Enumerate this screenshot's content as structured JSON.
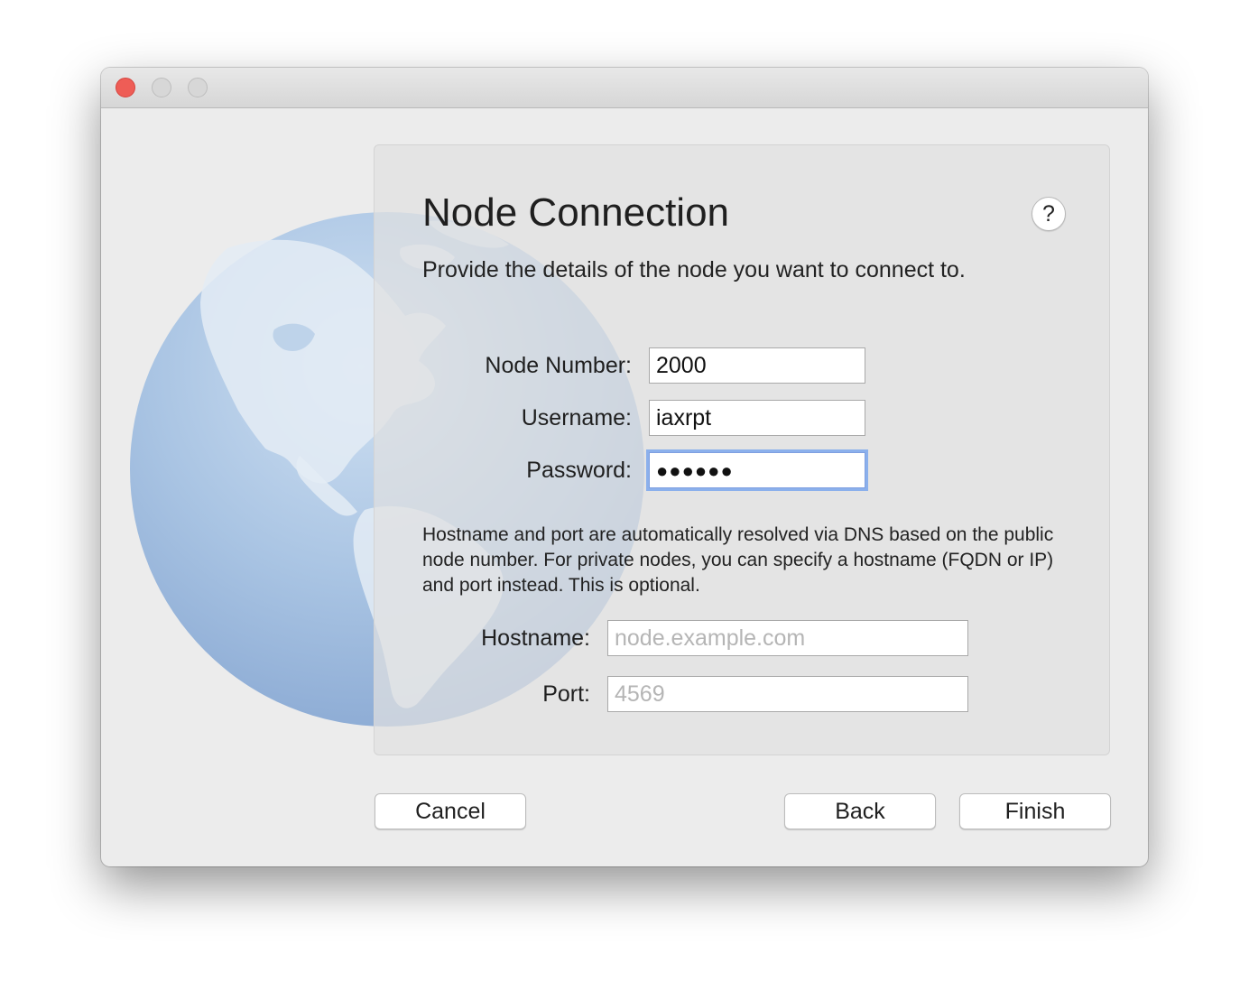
{
  "window": {
    "traffic_lights": [
      "close",
      "minimize",
      "zoom"
    ]
  },
  "dialog": {
    "title": "Node Connection",
    "subtitle": "Provide the details of the node you want to connect to.",
    "help_label": "?"
  },
  "form": {
    "node_number_label": "Node Number:",
    "node_number_value": "2000",
    "username_label": "Username:",
    "username_value": "iaxrpt",
    "password_label": "Password:",
    "password_masked": "●●●●●●",
    "info_text": "Hostname and port are automatically resolved via DNS based on the public node number. For private nodes, you can specify a hostname (FQDN or IP) and port instead. This is optional.",
    "hostname_label": "Hostname:",
    "hostname_placeholder": "node.example.com",
    "port_label": "Port:",
    "port_placeholder": "4569"
  },
  "buttons": {
    "cancel": "Cancel",
    "back": "Back",
    "finish": "Finish"
  },
  "colors": {
    "close_button": "#ee5d56",
    "focus_ring": "#8bb0ec",
    "globe": "#a8c4e4"
  }
}
